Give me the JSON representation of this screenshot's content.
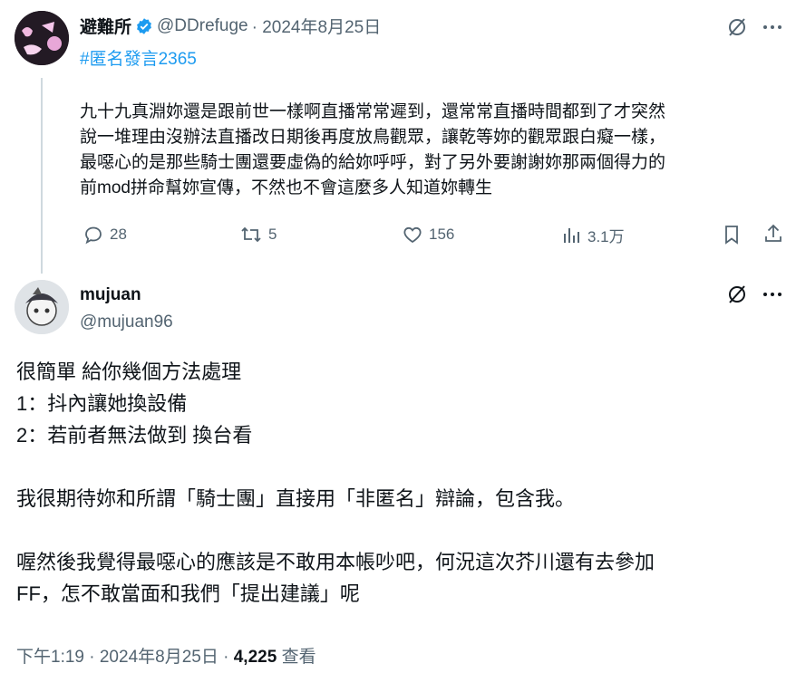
{
  "parent_tweet": {
    "display_name": "避難所",
    "handle": "@DDrefuge",
    "date": "· 2024年8月25日",
    "hashtag": "#匿名發言2365",
    "text_lines": [
      "九十九真淵妳還是跟前世一樣啊直播常常遲到，還常常直播時間都到了才突然",
      "說一堆理由沒辦法直播改日期後再度放鳥觀眾，讓乾等妳的觀眾跟白癡一樣，",
      "最噁心的是那些騎士團還要虛偽的給妳呼呼，對了另外要謝謝妳那兩個得力的",
      "前mod拼命幫妳宣傳，不然也不會這麼多人知道妳轉生"
    ],
    "replies": "28",
    "retweets": "5",
    "likes": "156",
    "views": "3.1万"
  },
  "reply_tweet": {
    "display_name": "mujuan",
    "handle": "@mujuan96",
    "text_lines": [
      "很簡單 給你幾個方法處理",
      "1：抖內讓她換設備",
      "2：若前者無法做到 換台看",
      "",
      "我很期待妳和所謂「騎士團」直接用「非匿名」辯論，包含我。",
      "",
      "喔然後我覺得最噁心的應該是不敢用本帳吵吧，何況這次芥川還有去參加",
      "FF，怎不敢當面和我們「提出建議」呢"
    ],
    "timestamp": "下午1:19 · 2024年8月25日 ·",
    "view_count": "4,225",
    "view_label": "查看"
  },
  "colors": {
    "accent": "#1d9bf0",
    "muted": "#536471",
    "verified": "#1d9bf0"
  },
  "icons": [
    "verified-badge-icon",
    "grok-icon",
    "more-icon",
    "reply-icon",
    "retweet-icon",
    "like-icon",
    "views-icon",
    "bookmark-icon",
    "share-icon"
  ]
}
